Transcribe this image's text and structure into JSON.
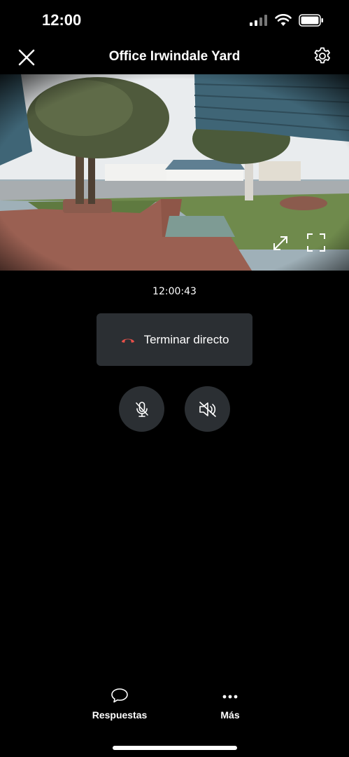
{
  "status_bar": {
    "time": "12:00"
  },
  "nav": {
    "title": "Office Irwindale Yard"
  },
  "live": {
    "timestamp": "12:00:43",
    "end_live_label": "Terminar directo"
  },
  "bottom_tabs": [
    {
      "label": "Respuestas",
      "icon": "chat-bubble-icon"
    },
    {
      "label": "Más",
      "icon": "more-dots-icon"
    }
  ],
  "colors": {
    "background": "#000000",
    "button": "#2b2f33",
    "end_call_red": "#e8504a"
  }
}
